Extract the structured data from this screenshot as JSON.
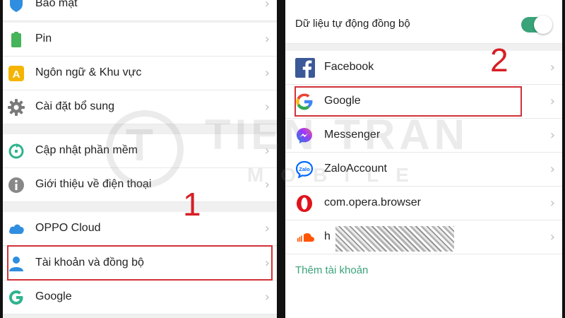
{
  "left": {
    "items": [
      {
        "label": "Bảo mật",
        "icon": "shield-icon"
      },
      {
        "label": "Pin",
        "icon": "battery-icon"
      },
      {
        "label": "Ngôn ngữ & Khu vực",
        "icon": "language-icon"
      },
      {
        "label": "Cài đặt bổ sung",
        "icon": "gear-icon"
      },
      {
        "label": "Cập nhật phần mềm",
        "icon": "update-icon"
      },
      {
        "label": "Giới thiệu về điện thoại",
        "icon": "info-icon"
      },
      {
        "label": "OPPO Cloud",
        "icon": "cloud-icon"
      },
      {
        "label": "Tài khoản và đồng bộ",
        "icon": "user-icon"
      },
      {
        "label": "Google",
        "icon": "google-icon"
      }
    ],
    "chevron": "›",
    "step_number": "1"
  },
  "right": {
    "sync_label": "Dữ liệu tự động đồng bộ",
    "sync_enabled": true,
    "accounts": [
      {
        "label": "Facebook",
        "icon": "facebook-icon"
      },
      {
        "label": "Google",
        "icon": "google-icon"
      },
      {
        "label": "Messenger",
        "icon": "messenger-icon"
      },
      {
        "label": "ZaloAccount",
        "icon": "zalo-icon"
      },
      {
        "label": "com.opera.browser",
        "icon": "opera-icon"
      },
      {
        "label": "h",
        "icon": "soundcloud-icon"
      }
    ],
    "add_account": "Thêm tài khoản",
    "step_number": "2"
  },
  "watermark": {
    "title": "TIEN TRAN",
    "subtitle": "MOBILE",
    "letter": "T"
  },
  "colors": {
    "accent": "#3aa37a",
    "highlight": "#d3313a",
    "step": "#d61f26",
    "panel_bg": "#f0f0f0"
  }
}
